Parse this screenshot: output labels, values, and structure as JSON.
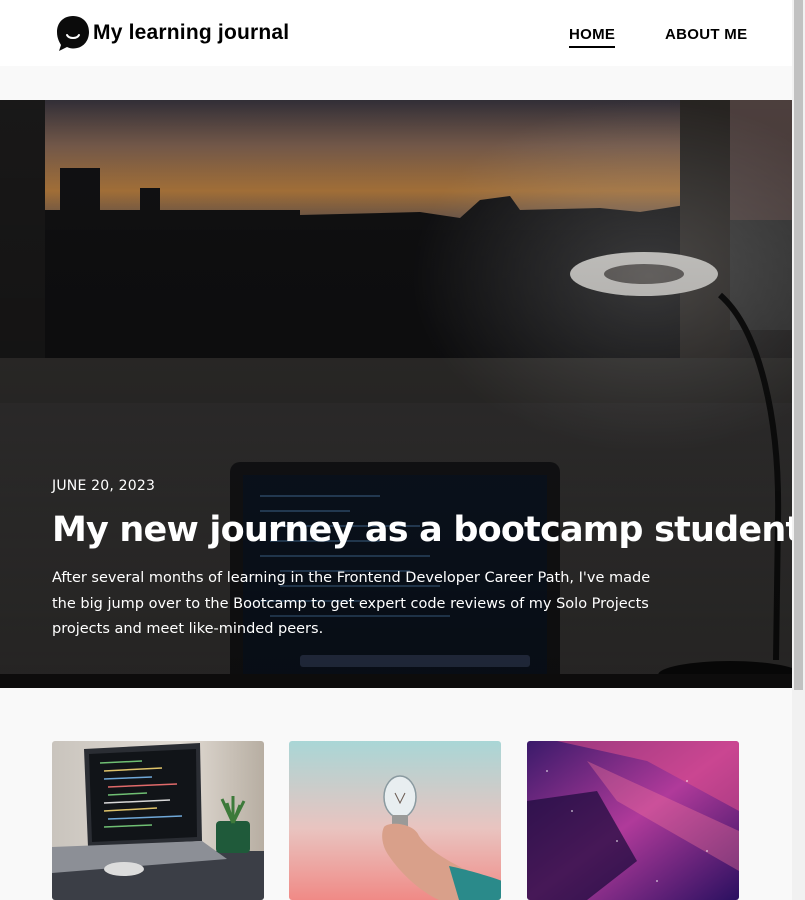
{
  "header": {
    "site_title": "My learning journal",
    "logo_icon": "chat-bubble-smile-icon",
    "nav": [
      {
        "label": "HOME",
        "active": true
      },
      {
        "label": "ABOUT ME",
        "active": false
      }
    ]
  },
  "hero": {
    "date": "JUNE 20, 2023",
    "title": "My new journey as a bootcamp student.",
    "text": "After several months of learning in the Frontend Developer Career Path, I've made the big jump over to the Bootcamp to get expert code reviews of my Solo Projects projects and meet like-minded peers.",
    "image": "laptop-desk-sunset-window"
  },
  "posts": [
    {
      "image": "laptop-code-plant"
    },
    {
      "image": "hand-holding-lightbulb"
    },
    {
      "image": "purple-abstract-light"
    }
  ],
  "colors": {
    "accent": "#000000",
    "page_bg": "#f9f9f9"
  }
}
